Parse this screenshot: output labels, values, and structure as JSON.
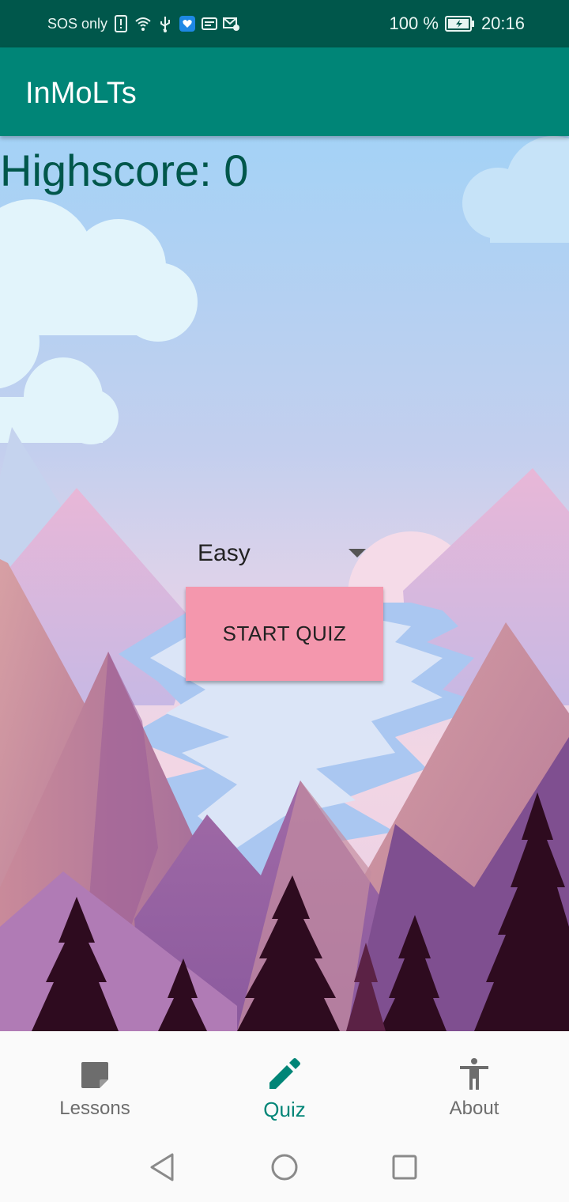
{
  "status_bar": {
    "carrier": "SOS only",
    "battery": "100 %",
    "time": "20:16",
    "icons": [
      "alert-icon",
      "wifi-icon",
      "usb-icon",
      "health-icon",
      "notification-icon",
      "mail-settings-icon",
      "battery-icon"
    ]
  },
  "app_bar": {
    "title": "InMoLTs"
  },
  "main": {
    "highscore_label": "Highscore: ",
    "highscore_value": "0",
    "difficulty_selected": "Easy",
    "start_button": "START QUIZ"
  },
  "bottom_nav": {
    "items": [
      {
        "label": "Lessons",
        "icon": "book-icon",
        "active": false
      },
      {
        "label": "Quiz",
        "icon": "pencil-icon",
        "active": true
      },
      {
        "label": "About",
        "icon": "accessibility-icon",
        "active": false
      }
    ]
  },
  "colors": {
    "primary": "#008577",
    "primary_dark": "#00574b",
    "button": "#f497ad",
    "nav_inactive": "#6d6d6d"
  }
}
